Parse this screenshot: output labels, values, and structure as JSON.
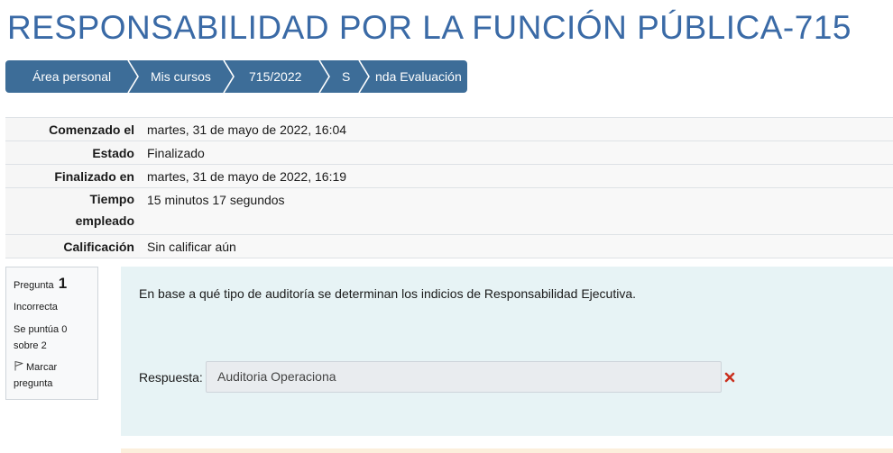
{
  "page": {
    "title": "RESPONSABILIDAD POR LA FUNCIÓN PÚBLICA-715"
  },
  "breadcrumb": {
    "items": [
      {
        "label": "Área personal"
      },
      {
        "label": "Mis cursos"
      },
      {
        "label": "715/2022"
      },
      {
        "label": "S"
      },
      {
        "label": "nda Evaluación"
      }
    ]
  },
  "summary": {
    "rows": [
      {
        "label": "Comenzado el",
        "value": "martes, 31 de mayo de 2022, 16:04"
      },
      {
        "label": "Estado",
        "value": "Finalizado"
      },
      {
        "label": "Finalizado en",
        "value": "martes, 31 de mayo de 2022, 16:19"
      },
      {
        "label_line1": "Tiempo",
        "label_line2": "empleado",
        "value": "15 minutos 17 segundos"
      },
      {
        "label": "Calificación",
        "value": "Sin calificar aún"
      }
    ]
  },
  "question": {
    "prefix": "Pregunta",
    "number": "1",
    "state": "Incorrecta",
    "grade_line1": "Se puntúa 0",
    "grade_line2": "sobre 2",
    "flag_line1": "Marcar",
    "flag_line2": "pregunta",
    "text": "En base a qué tipo de auditoría se determinan los indicios de Responsabilidad Ejecutiva.",
    "answer_label": "Respuesta:",
    "answer_value": "Auditoria Operaciona",
    "answer_status_icon": "incorrect-x-icon"
  },
  "colors": {
    "title": "#3a6aa6",
    "breadcrumb_bg": "#3d6d98",
    "question_bg": "#e7f3f5",
    "incorrect": "#ca3120"
  }
}
